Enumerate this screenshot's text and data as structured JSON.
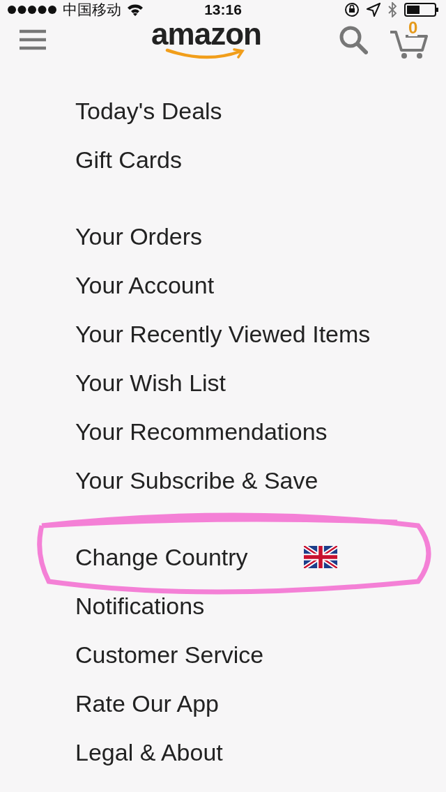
{
  "status_bar": {
    "carrier": "中国移动",
    "time": "13:16"
  },
  "header": {
    "logo": "amazon",
    "cart_count": "0"
  },
  "sections": [
    {
      "items": [
        {
          "label": "Today's Deals",
          "flag": false,
          "circled": false
        },
        {
          "label": "Gift Cards",
          "flag": false,
          "circled": false
        }
      ]
    },
    {
      "items": [
        {
          "label": "Your Orders",
          "flag": false,
          "circled": false
        },
        {
          "label": "Your Account",
          "flag": false,
          "circled": false
        },
        {
          "label": "Your Recently Viewed Items",
          "flag": false,
          "circled": false
        },
        {
          "label": "Your Wish List",
          "flag": false,
          "circled": false
        },
        {
          "label": "Your Recommendations",
          "flag": false,
          "circled": false
        },
        {
          "label": "Your Subscribe & Save",
          "flag": false,
          "circled": false
        }
      ]
    },
    {
      "items": [
        {
          "label": "Change Country",
          "flag": true,
          "circled": true
        },
        {
          "label": "Notifications",
          "flag": false,
          "circled": false
        },
        {
          "label": "Customer Service",
          "flag": false,
          "circled": false
        },
        {
          "label": "Rate Our App",
          "flag": false,
          "circled": false
        },
        {
          "label": "Legal & About",
          "flag": false,
          "circled": false
        }
      ]
    }
  ]
}
